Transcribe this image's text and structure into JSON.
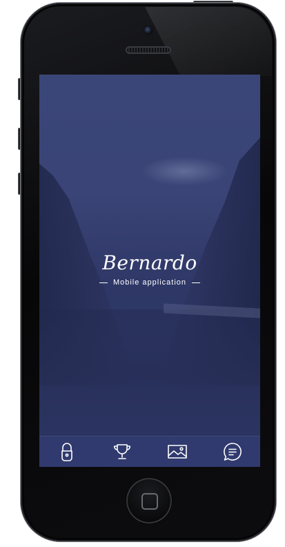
{
  "app": {
    "title": "Bernardo",
    "subtitle": "Mobile application"
  },
  "tabbar": {
    "items": [
      {
        "icon": "lock-icon"
      },
      {
        "icon": "trophy-icon"
      },
      {
        "icon": "image-icon"
      },
      {
        "icon": "chat-icon"
      }
    ]
  },
  "colors": {
    "overlay": "#2f3868",
    "tabbar": "#303a6e",
    "text": "#ffffff",
    "device": "#0a0a0c"
  }
}
